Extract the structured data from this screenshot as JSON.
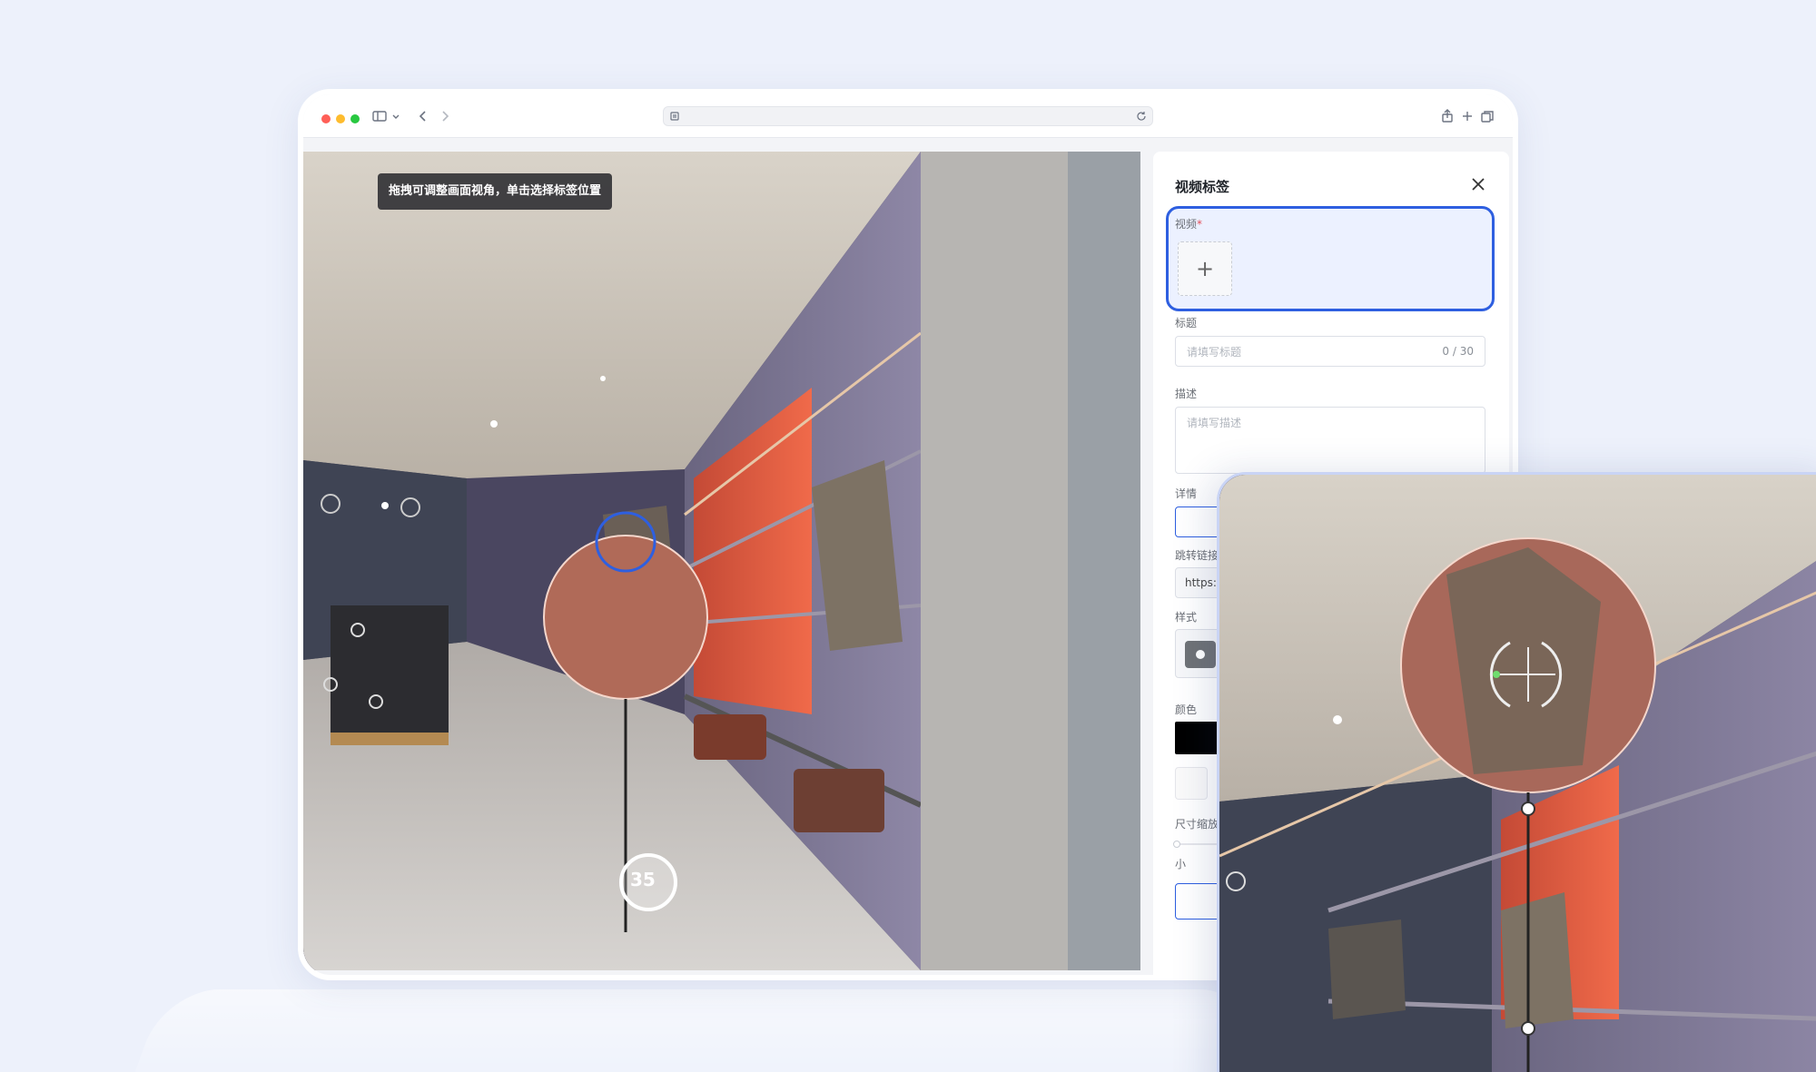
{
  "viewer": {
    "hint": "拖拽可调整画面视角，单击选择标签位置",
    "hotspot_number": "35"
  },
  "panel": {
    "title": "视频标签",
    "video_label": "视频",
    "required_mark": "*",
    "upload_plus": "+",
    "title_label": "标题",
    "title_placeholder": "请填写标题",
    "title_counter": "0 / 30",
    "desc_label": "描述",
    "desc_placeholder": "请填写描述",
    "detail_label": "详情",
    "link_label": "跳转链接",
    "link_value": "https:",
    "style_label": "样式",
    "color_label": "颜色",
    "size_label": "尺寸缩放",
    "size_small": "小"
  },
  "colors": {
    "accent": "#2e5fe0",
    "swatch_selected": "#000000"
  }
}
